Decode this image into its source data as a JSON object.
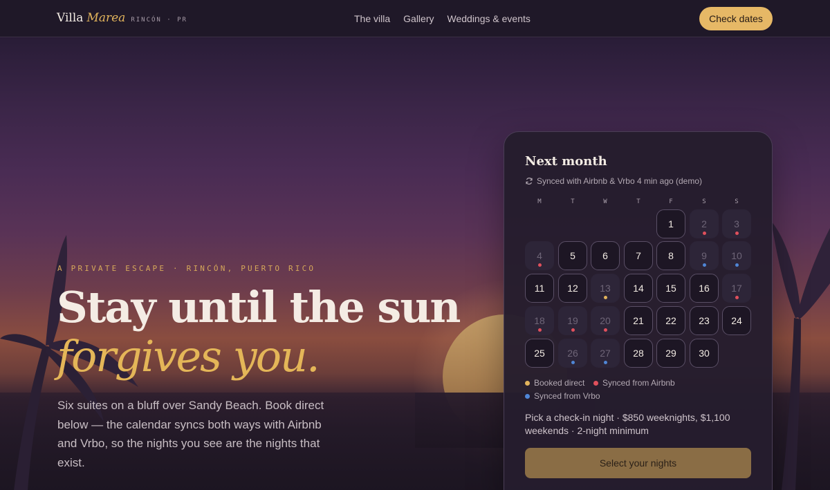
{
  "colors": {
    "accent": "#e6b866",
    "booked_direct": "#e2b45c",
    "airbnb": "#e0505c",
    "vrbo": "#4f86d6"
  },
  "nav": {
    "brand_name": "Villa",
    "brand_accent": "Marea",
    "brand_location": "RINCÓN · PR",
    "links": [
      "The villa",
      "Gallery",
      "Weddings & events"
    ],
    "cta_label": "Check dates"
  },
  "hero": {
    "eyebrow": "A PRIVATE ESCAPE · RINCÓN, PUERTO RICO",
    "headline": "Stay until the sun",
    "headline_accent": "forgives you.",
    "lede": "Six suites on a bluff over Sandy Beach. Book direct below — the calendar syncs both ways with Airbnb and Vrbo, so the nights you see are the nights that exist."
  },
  "calendar": {
    "title": "Next month",
    "sync_icon": "refresh-icon",
    "sync_text": "Synced with Airbnb & Vrbo 4 min ago (demo)",
    "weekdays": [
      "M",
      "T",
      "W",
      "T",
      "F",
      "S",
      "S"
    ],
    "first_weekday_index": 4,
    "days": [
      {
        "day": "1",
        "status": "available"
      },
      {
        "day": "2",
        "status": "airbnb"
      },
      {
        "day": "3",
        "status": "airbnb"
      },
      {
        "day": "4",
        "status": "airbnb"
      },
      {
        "day": "5",
        "status": "available"
      },
      {
        "day": "6",
        "status": "available"
      },
      {
        "day": "7",
        "status": "available"
      },
      {
        "day": "8",
        "status": "available"
      },
      {
        "day": "9",
        "status": "vrbo"
      },
      {
        "day": "10",
        "status": "vrbo"
      },
      {
        "day": "11",
        "status": "available"
      },
      {
        "day": "12",
        "status": "available"
      },
      {
        "day": "13",
        "status": "direct"
      },
      {
        "day": "14",
        "status": "available"
      },
      {
        "day": "15",
        "status": "available"
      },
      {
        "day": "16",
        "status": "available"
      },
      {
        "day": "17",
        "status": "airbnb"
      },
      {
        "day": "18",
        "status": "airbnb"
      },
      {
        "day": "19",
        "status": "airbnb"
      },
      {
        "day": "20",
        "status": "airbnb"
      },
      {
        "day": "21",
        "status": "available"
      },
      {
        "day": "22",
        "status": "available"
      },
      {
        "day": "23",
        "status": "available"
      },
      {
        "day": "24",
        "status": "available"
      },
      {
        "day": "25",
        "status": "available"
      },
      {
        "day": "26",
        "status": "vrbo"
      },
      {
        "day": "27",
        "status": "vrbo"
      },
      {
        "day": "28",
        "status": "available"
      },
      {
        "day": "29",
        "status": "available"
      },
      {
        "day": "30",
        "status": "available"
      }
    ],
    "legend": {
      "direct": "Booked direct",
      "airbnb": "Synced from Airbnb",
      "vrbo": "Synced from Vrbo"
    },
    "hint": "Pick a check-in night · $850 weeknights, $1,100 weekends · 2-night minimum",
    "button_label": "Select your nights"
  }
}
